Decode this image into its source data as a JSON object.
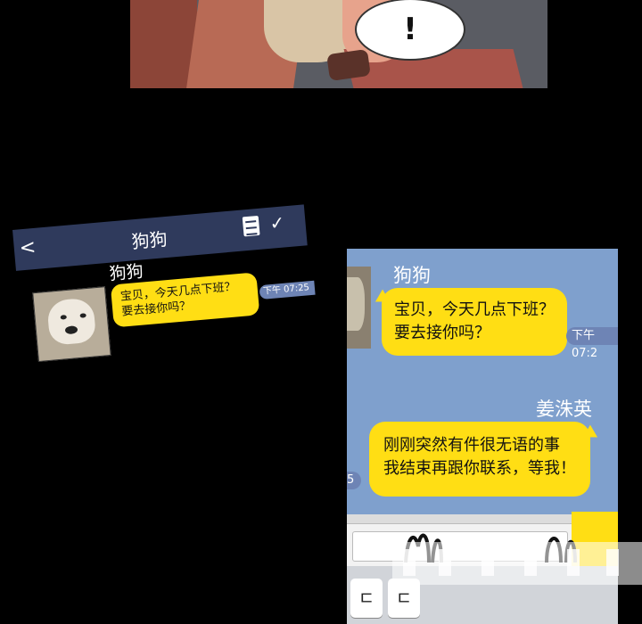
{
  "top_panel": {
    "speech_text": "!"
  },
  "tilted_chat": {
    "back_glyph": "<",
    "title": "狗狗",
    "check_glyph": "✓",
    "sender_name": "狗狗",
    "message_line1": "宝贝，今天几点下班？",
    "message_line2": "要去接你吗？",
    "time": "下午 07:25"
  },
  "phone_chat": {
    "sender_name": "狗狗",
    "message_line1": "宝贝，今天几点下班？",
    "message_line2": "要去接你吗？",
    "time": "下午 07:2",
    "reply_name": "姜洙英",
    "reply_line1": "刚刚突然有件很无语的事",
    "reply_line2": "我结束再跟你联系，等我！",
    "reply_time": "5",
    "keyboard_keys": [
      "ㄷ",
      "ㄷ"
    ]
  },
  "colors": {
    "bubble_yellow": "#ffde14",
    "chat_bg_blue": "#7fa0cd",
    "header_navy": "#2f3a5c",
    "time_badge": "#6e84b5"
  }
}
